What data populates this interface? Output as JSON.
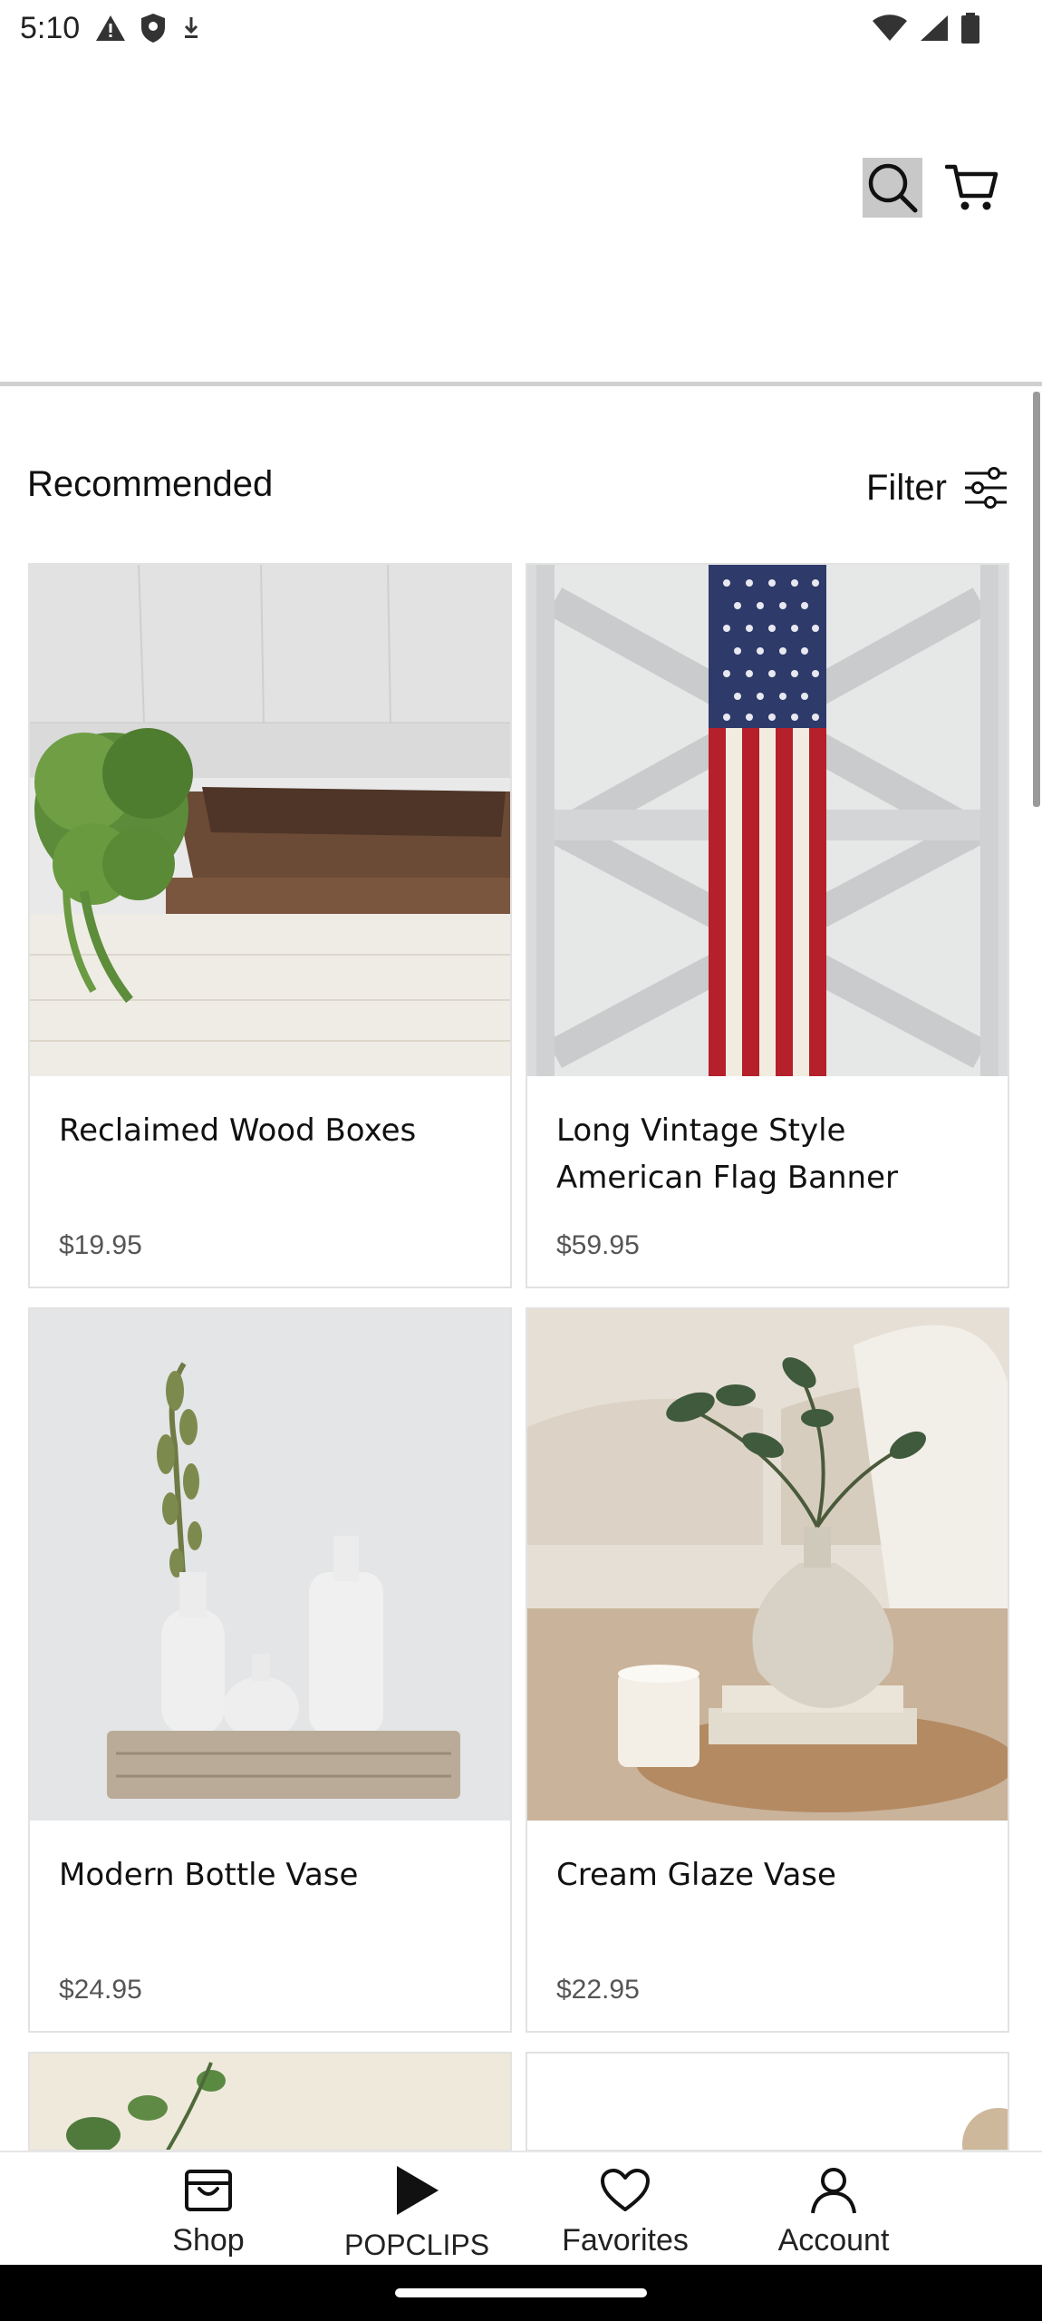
{
  "status_bar": {
    "time": "5:10",
    "left_icons": [
      "warning-icon",
      "shield-icon",
      "download-icon"
    ],
    "right_icons": [
      "wifi-icon",
      "signal-icon",
      "battery-icon"
    ]
  },
  "header": {
    "search_icon": "search-icon",
    "cart_icon": "cart-icon"
  },
  "section": {
    "title": "Recommended",
    "filter_label": "Filter",
    "filter_icon": "sliders-icon"
  },
  "products": [
    {
      "name": "Reclaimed Wood Boxes",
      "price": "$19.95"
    },
    {
      "name": "Long Vintage Style American Flag Banner",
      "price": "$59.95"
    },
    {
      "name": "Modern Bottle Vase",
      "price": "$24.95"
    },
    {
      "name": "Cream Glaze Vase",
      "price": "$22.95"
    }
  ],
  "bottom_nav": [
    {
      "label": "Shop",
      "icon": "shopping-bag-icon"
    },
    {
      "label": "POPCLIPS",
      "icon": "play-icon"
    },
    {
      "label": "Favorites",
      "icon": "heart-icon"
    },
    {
      "label": "Account",
      "icon": "person-icon"
    }
  ],
  "colors": {
    "search_highlight": "#c8c8c8",
    "border": "#e2e2e2",
    "text": "#111111",
    "price": "#555555"
  }
}
